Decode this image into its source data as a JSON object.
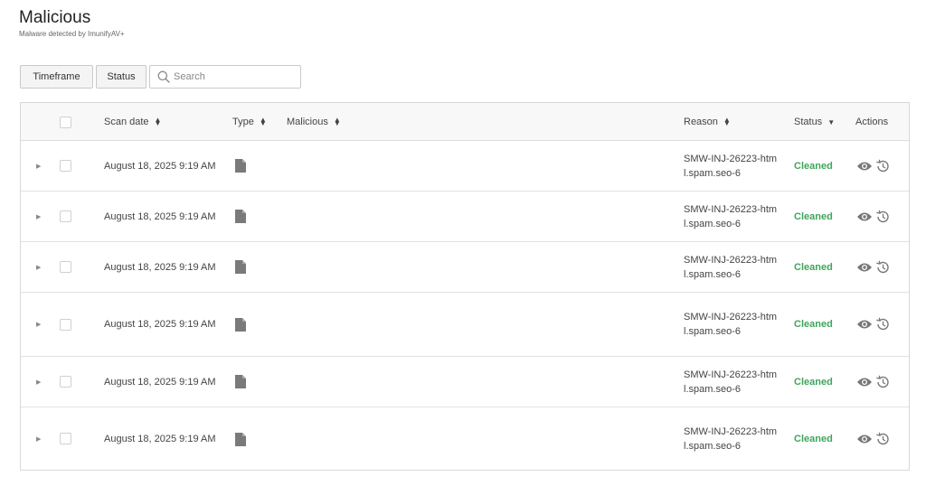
{
  "header": {
    "title": "Malicious",
    "subtitle": "Malware detected by ImunifyAV+"
  },
  "filters": {
    "timeframe_label": "Timeframe",
    "status_label": "Status",
    "search_placeholder": "Search"
  },
  "table": {
    "columns": {
      "scan_date": "Scan date",
      "type": "Type",
      "malicious": "Malicious",
      "reason": "Reason",
      "status": "Status",
      "actions": "Actions"
    },
    "rows": [
      {
        "scan_date": "August 18, 2025 9:19 AM",
        "type_icon": "file-icon",
        "malicious": "",
        "reason_line1": "SMW-INJ-26223-htm",
        "reason_line2": "l.spam.seo-6",
        "status": "Cleaned"
      },
      {
        "scan_date": "August 18, 2025 9:19 AM",
        "type_icon": "file-icon",
        "malicious": "",
        "reason_line1": "SMW-INJ-26223-htm",
        "reason_line2": "l.spam.seo-6",
        "status": "Cleaned"
      },
      {
        "scan_date": "August 18, 2025 9:19 AM",
        "type_icon": "file-icon",
        "malicious": "",
        "reason_line1": "SMW-INJ-26223-htm",
        "reason_line2": "l.spam.seo-6",
        "status": "Cleaned"
      },
      {
        "scan_date": "August 18, 2025 9:19 AM",
        "type_icon": "file-icon",
        "malicious": "",
        "reason_line1": "SMW-INJ-26223-htm",
        "reason_line2": "l.spam.seo-6",
        "status": "Cleaned"
      },
      {
        "scan_date": "August 18, 2025 9:19 AM",
        "type_icon": "file-icon",
        "malicious": "",
        "reason_line1": "SMW-INJ-26223-htm",
        "reason_line2": "l.spam.seo-6",
        "status": "Cleaned"
      },
      {
        "scan_date": "August 18, 2025 9:19 AM",
        "type_icon": "file-icon",
        "malicious": "",
        "reason_line1": "SMW-INJ-26223-htm",
        "reason_line2": "l.spam.seo-6",
        "status": "Cleaned"
      }
    ]
  },
  "colors": {
    "cleaned": "#3fa55c",
    "header_bg": "#f7f8f7",
    "icon_gray": "#7a7a7a"
  }
}
